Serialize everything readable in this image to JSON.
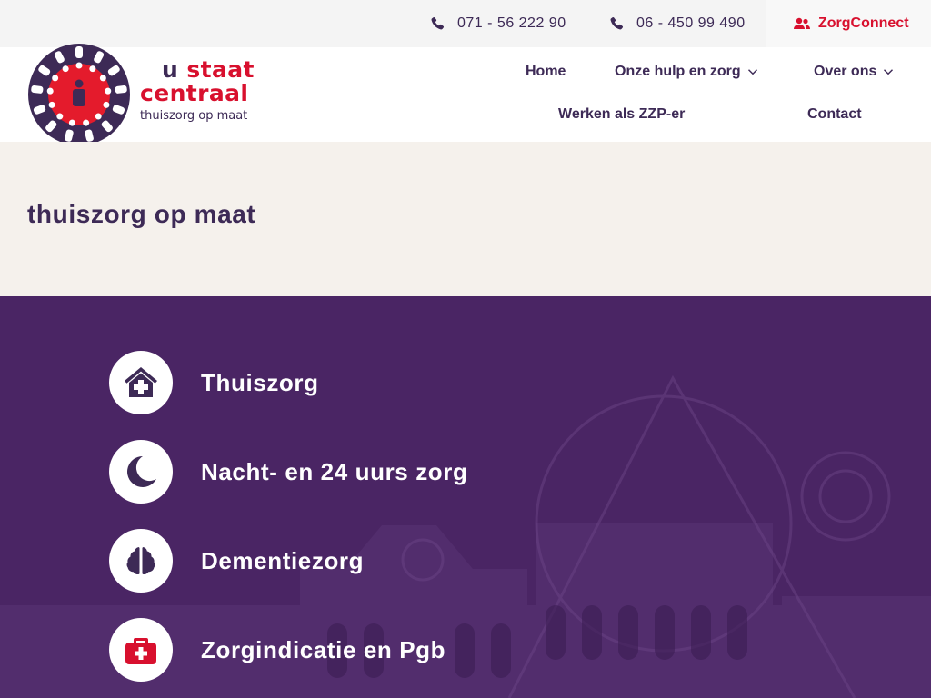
{
  "topbar": {
    "phone1": {
      "icon": "phone-icon",
      "text": "071 - 56 222 90"
    },
    "phone2": {
      "icon": "phone-icon",
      "text": "06 - 450 99 490"
    },
    "zorgconnect": {
      "icon": "users-icon",
      "label": "ZorgConnect",
      "color": "#d8102e"
    }
  },
  "logo": {
    "word1": "u",
    "word2": "staat",
    "word3": "centraal",
    "tagline": "thuiszorg op maat"
  },
  "nav": {
    "home": "Home",
    "hulp": "Onze hulp en zorg",
    "over": "Over ons",
    "zzp": "Werken als ZZP-er",
    "contact": "Contact"
  },
  "hero": {
    "title_light": "thuiszorg",
    "title_bold": "op maat"
  },
  "services": [
    {
      "label": "Thuiszorg",
      "icon": "clinic-house-icon"
    },
    {
      "label": "Nacht- en 24 uurs zorg",
      "icon": "moon-icon"
    },
    {
      "label": "Dementiezorg",
      "icon": "brain-icon"
    },
    {
      "label": "Zorgindicatie en Pgb",
      "icon": "medical-kit-icon"
    }
  ],
  "colors": {
    "primary": "#3d2a56",
    "accent": "#d8102e",
    "hero_bg": "#f5f1ec",
    "services_bg": "#4a2564"
  }
}
